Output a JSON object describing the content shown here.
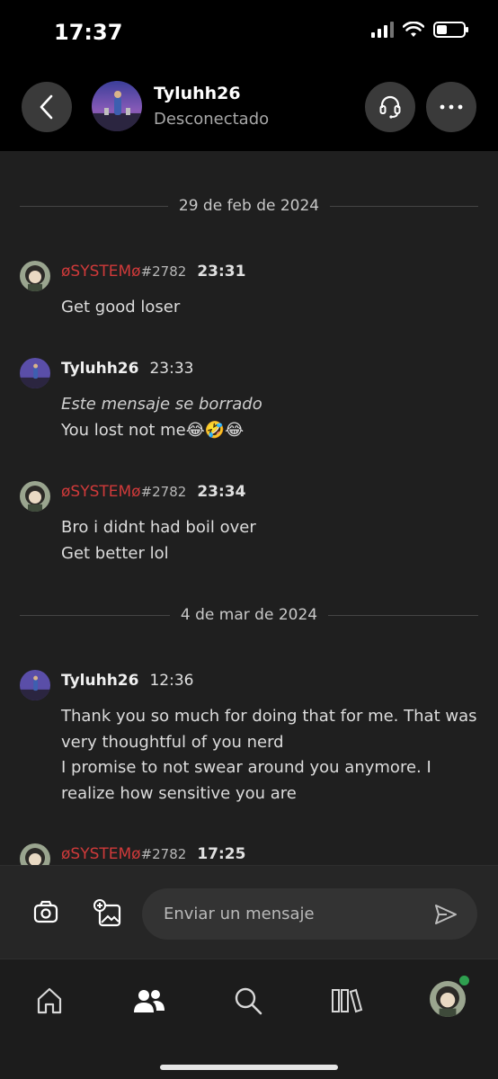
{
  "status_bar": {
    "time": "17:37"
  },
  "header": {
    "contact_name": "Tyluhh26",
    "contact_status": "Desconectado"
  },
  "conversation": {
    "dates": [
      "29 de feb de 2024",
      "4 de mar de 2024"
    ],
    "messages": [
      {
        "sender": "øSYSTEMø",
        "tag": "#2782",
        "time": "23:31",
        "lines": [
          "Get good loser"
        ]
      },
      {
        "sender": "Tyluhh26",
        "time": "23:33",
        "deleted_note": "Este mensaje se borrado",
        "lines": [
          "You lost not me😂🤣😂"
        ]
      },
      {
        "sender": "øSYSTEMø",
        "tag": "#2782",
        "time": "23:34",
        "lines": [
          "Bro i didnt had boil over",
          "Get better lol"
        ]
      },
      {
        "sender": "Tyluhh26",
        "time": "12:36",
        "lines": [
          "Thank you so much for doing that for me. That was very thoughtful of you nerd",
          "I promise to not swear around you anymore. I realize how sensitive you are"
        ]
      },
      {
        "sender": "øSYSTEMø",
        "tag": "#2782",
        "time": "17:25",
        "lines": []
      }
    ]
  },
  "composer": {
    "placeholder": "Enviar un mensaje"
  },
  "nav": {
    "items": [
      "home-icon",
      "friends-icon",
      "search-icon",
      "library-icon",
      "profile-avatar"
    ]
  },
  "colors": {
    "accent_red": "#d03a3a",
    "online_green": "#2ea04f",
    "background": "#1f1f1f"
  }
}
